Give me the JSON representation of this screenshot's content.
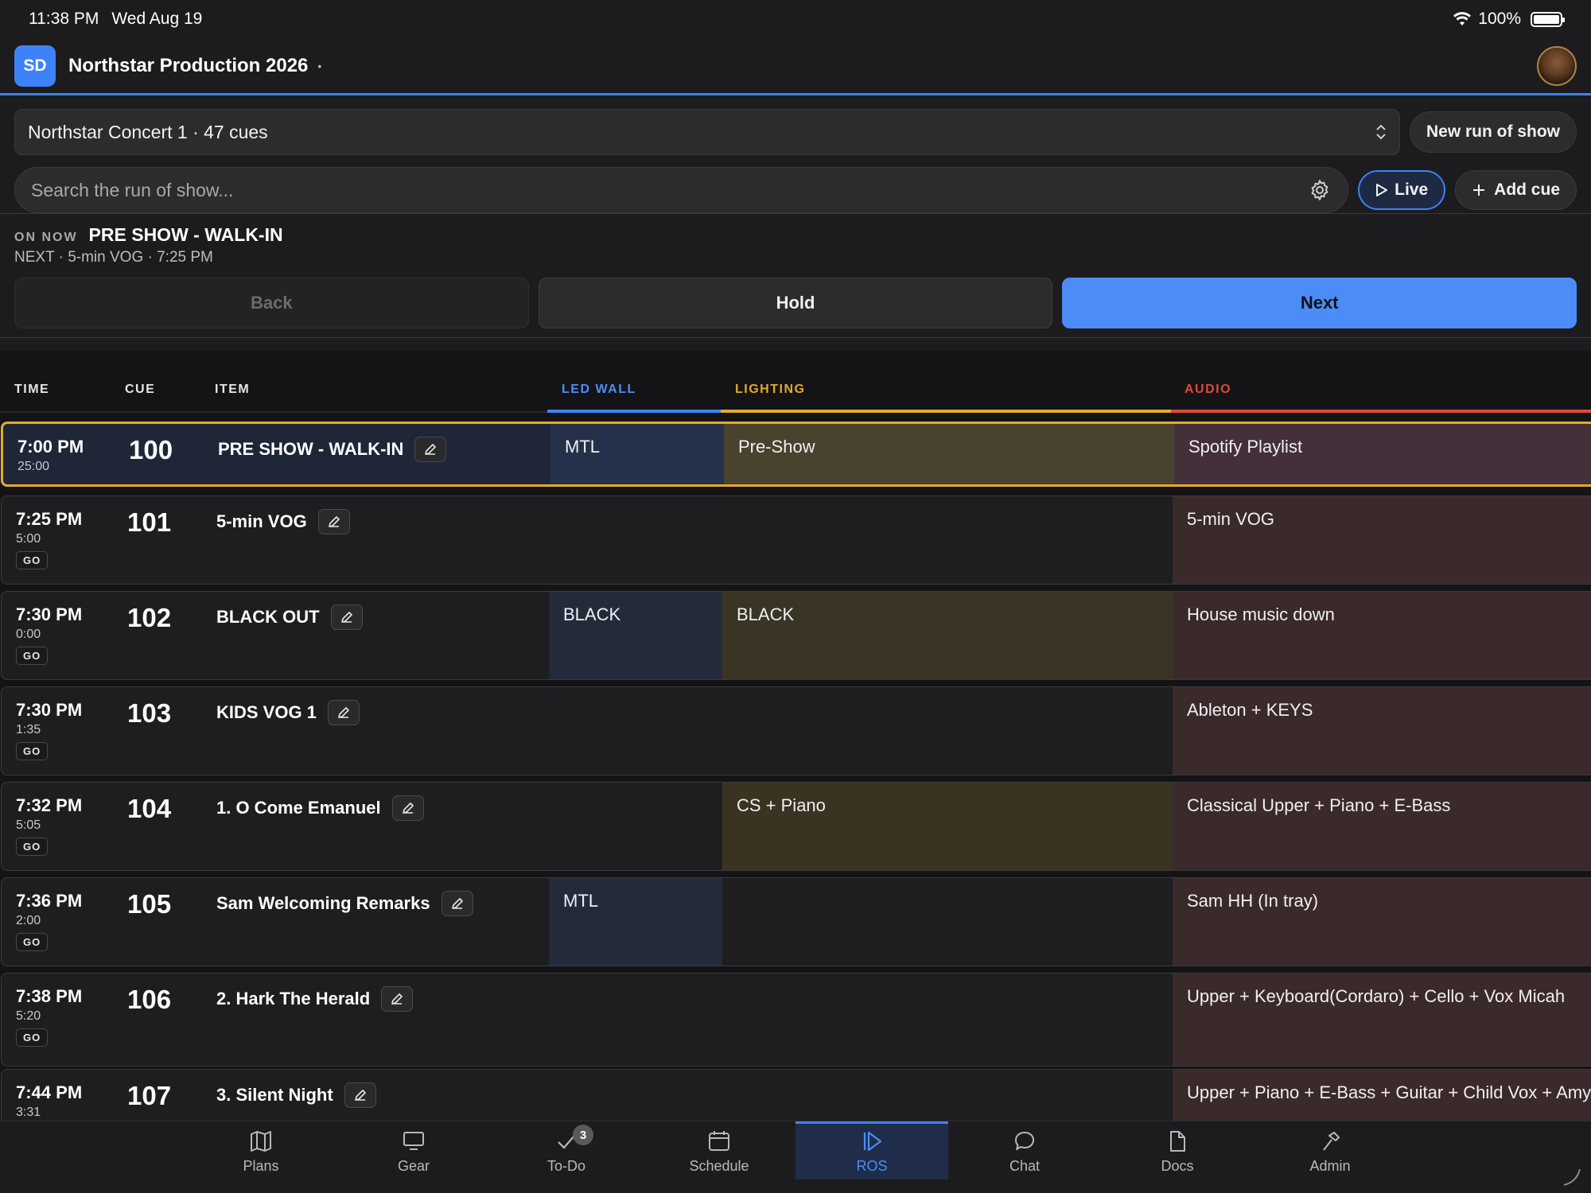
{
  "status_bar": {
    "time": "11:38 PM",
    "date": "Wed Aug 19",
    "battery": "100%"
  },
  "header": {
    "workspace_initials": "SD",
    "project_title": "Northstar Production 2026"
  },
  "ros_selector": {
    "value": "Northstar Concert 1 · 47 cues",
    "new_button": "New run of show"
  },
  "search": {
    "placeholder": "Search the run of show...",
    "live_button": "Live",
    "add_cue_button": "Add cue"
  },
  "on_now": {
    "label": "ON NOW",
    "title": "PRE SHOW - WALK-IN",
    "next_line": "NEXT · 5-min VOG · 7:25 PM"
  },
  "transport": {
    "back": "Back",
    "hold": "Hold",
    "next": "Next"
  },
  "columns": {
    "time": "TIME",
    "cue": "CUE",
    "item": "ITEM",
    "led_wall": "LED WALL",
    "lighting": "LIGHTING",
    "audio": "AUDIO"
  },
  "colors": {
    "accent": "#3d82f6",
    "led_wall": "#3d82f6",
    "lighting": "#e6a92a",
    "audio": "#e0483e",
    "active_row_border": "#e6a92a"
  },
  "cues": [
    {
      "time": "7:00 PM",
      "duration": "25:00",
      "go": "",
      "cue": "100",
      "item": "PRE SHOW - WALK-IN",
      "led_wall": "MTL",
      "lighting": "Pre-Show",
      "audio": "Spotify Playlist",
      "active": true
    },
    {
      "time": "7:25 PM",
      "duration": "5:00",
      "go": "GO",
      "cue": "101",
      "item": "5-min VOG",
      "led_wall": "",
      "lighting": "",
      "audio": "5-min VOG"
    },
    {
      "time": "7:30 PM",
      "duration": "0:00",
      "go": "GO",
      "cue": "102",
      "item": "BLACK OUT",
      "led_wall": "BLACK",
      "lighting": "BLACK",
      "audio": "House music down"
    },
    {
      "time": "7:30 PM",
      "duration": "1:35",
      "go": "GO",
      "cue": "103",
      "item": "KIDS VOG 1",
      "led_wall": "",
      "lighting": "",
      "audio": "Ableton + KEYS"
    },
    {
      "time": "7:32 PM",
      "duration": "5:05",
      "go": "GO",
      "cue": "104",
      "item": "1. O Come Emanuel",
      "led_wall": "",
      "lighting": "CS + Piano",
      "audio": "Classical Upper + Piano + E-Bass"
    },
    {
      "time": "7:36 PM",
      "duration": "2:00",
      "go": "GO",
      "cue": "105",
      "item": "Sam Welcoming Remarks",
      "led_wall": "MTL",
      "lighting": "",
      "audio": "Sam HH (In tray)"
    },
    {
      "time": "7:38 PM",
      "duration": "5:20",
      "go": "GO",
      "cue": "106",
      "item": "2. Hark The Herald",
      "led_wall": "",
      "lighting": "",
      "audio": "Upper + Keyboard(Cordaro) + Cello + Vox Micah"
    },
    {
      "time": "7:44 PM",
      "duration": "3:31",
      "go": "",
      "cue": "107",
      "item": "3. Silent Night",
      "led_wall": "",
      "lighting": "",
      "audio": "Upper + Piano + E-Bass + Guitar + Child Vox + Amy"
    }
  ],
  "tabs": [
    {
      "label": "Plans",
      "icon": "map-icon"
    },
    {
      "label": "Gear",
      "icon": "monitor-icon"
    },
    {
      "label": "To-Do",
      "icon": "checkmark-icon",
      "badge": "3"
    },
    {
      "label": "Schedule",
      "icon": "calendar-icon"
    },
    {
      "label": "ROS",
      "icon": "play-icon",
      "active": true
    },
    {
      "label": "Chat",
      "icon": "chat-bubble-icon"
    },
    {
      "label": "Docs",
      "icon": "document-icon"
    },
    {
      "label": "Admin",
      "icon": "hammer-icon"
    }
  ]
}
